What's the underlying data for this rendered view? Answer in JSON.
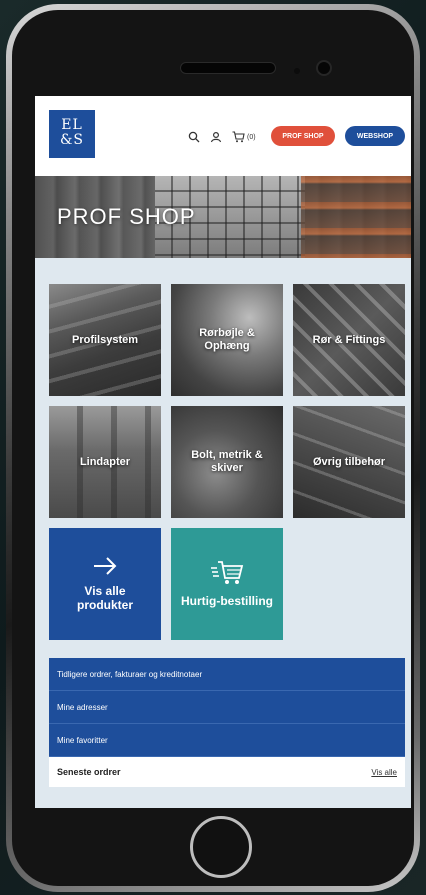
{
  "header": {
    "logo_line1": "EL",
    "logo_line2": "&S",
    "cart_count": "(0)",
    "prof_shop_label": "PROF SHOP",
    "webshop_label": "WEBSHOP"
  },
  "hero": {
    "title": "PROF SHOP"
  },
  "categories": [
    {
      "label": "Profilsystem"
    },
    {
      "label": "Rørbøjle & Ophæng"
    },
    {
      "label": "Rør & Fittings"
    },
    {
      "label": "Lindapter"
    },
    {
      "label": "Bolt, metrik & skiver"
    },
    {
      "label": "Øvrig tilbehør"
    }
  ],
  "actions": {
    "all_products": "Vis alle produkter",
    "quick_order": "Hurtig-bestilling"
  },
  "links": [
    "Tidligere ordrer, fakturaer og kreditnotaer",
    "Mine adresser",
    "Mine favoritter"
  ],
  "orders": {
    "title": "Seneste ordrer",
    "see_all": "Vis alle"
  },
  "colors": {
    "brand_blue": "#1e4e9b",
    "accent_red": "#e0503b",
    "teal": "#2e9a96"
  }
}
